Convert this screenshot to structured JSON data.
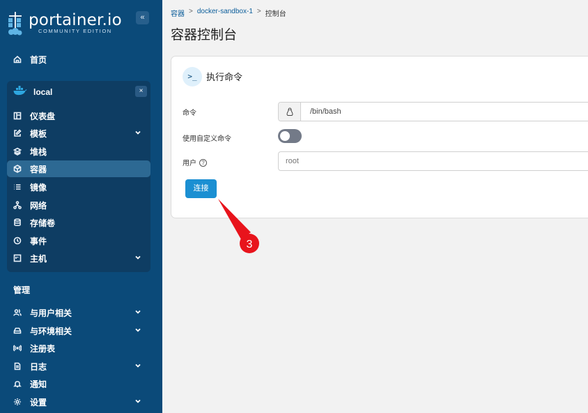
{
  "sidebar": {
    "logo_text": "portainer.io",
    "logo_sub": "COMMUNITY EDITION",
    "collapse": "«",
    "home": "首页",
    "environment": {
      "name": "local",
      "close": "×"
    },
    "env_items": [
      {
        "label": "仪表盘",
        "icon": "dashboard-icon"
      },
      {
        "label": "模板",
        "icon": "edit-icon",
        "expandable": true
      },
      {
        "label": "堆栈",
        "icon": "layers-icon"
      },
      {
        "label": "容器",
        "icon": "box-icon",
        "active": true
      },
      {
        "label": "镜像",
        "icon": "list-icon"
      },
      {
        "label": "网络",
        "icon": "network-icon"
      },
      {
        "label": "存储卷",
        "icon": "database-icon"
      },
      {
        "label": "事件",
        "icon": "clock-icon"
      },
      {
        "label": "主机",
        "icon": "host-icon",
        "expandable": true
      }
    ],
    "section": "管理",
    "admin_items": [
      {
        "label": "与用户相关",
        "icon": "users-icon",
        "expandable": true
      },
      {
        "label": "与环境相关",
        "icon": "drive-icon",
        "expandable": true
      },
      {
        "label": "注册表",
        "icon": "radio-icon"
      },
      {
        "label": "日志",
        "icon": "file-icon",
        "expandable": true
      },
      {
        "label": "通知",
        "icon": "bell-icon"
      },
      {
        "label": "设置",
        "icon": "gear-icon",
        "expandable": true
      }
    ]
  },
  "breadcrumb": {
    "root": "容器",
    "sep1": ">",
    "container": "docker-sandbox-1",
    "sep2": ">",
    "current": "控制台"
  },
  "page_title": "容器控制台",
  "card": {
    "icon": ">_",
    "title": "执行命令",
    "command_label": "命令",
    "command_value": "/bin/bash",
    "custom_label": "使用自定义命令",
    "user_label": "用户",
    "user_help": "?",
    "user_placeholder": "root",
    "connect": "连接"
  },
  "annotation": {
    "number": "3",
    "color": "#e8141c"
  }
}
